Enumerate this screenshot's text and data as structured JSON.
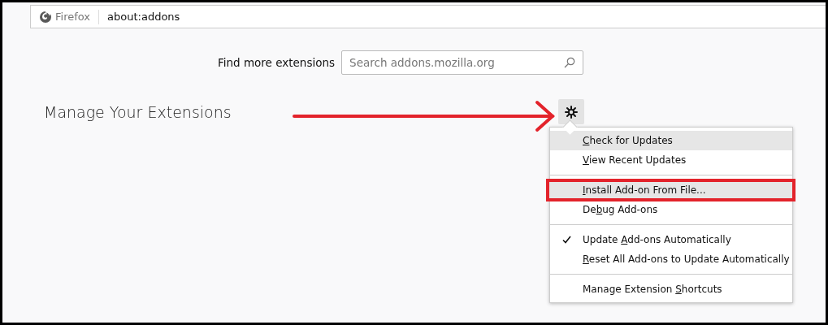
{
  "url_bar": {
    "identity": "Firefox",
    "url": "about:addons"
  },
  "find_more": {
    "label": "Find more extensions",
    "placeholder": "Search addons.mozilla.org"
  },
  "heading": "Manage Your Extensions",
  "annotation_arrow": {
    "kind": "arrow"
  },
  "menu": {
    "groups": [
      [
        {
          "label_parts": [
            {
              "text": "C",
              "underlined": true
            },
            {
              "text": "heck for Updates",
              "underlined": false
            }
          ],
          "selected": true,
          "checked": false,
          "outlined": false
        },
        {
          "label_parts": [
            {
              "text": "V",
              "underlined": true
            },
            {
              "text": "iew Recent Updates",
              "underlined": false
            }
          ],
          "selected": false,
          "checked": false,
          "outlined": false
        }
      ],
      [
        {
          "label_parts": [
            {
              "text": "I",
              "underlined": true
            },
            {
              "text": "nstall Add-on From File...",
              "underlined": false
            }
          ],
          "selected": true,
          "checked": false,
          "outlined": true
        },
        {
          "label_parts": [
            {
              "text": "De",
              "underlined": false
            },
            {
              "text": "b",
              "underlined": true
            },
            {
              "text": "ug Add-ons",
              "underlined": false
            }
          ],
          "selected": false,
          "checked": false,
          "outlined": false
        }
      ],
      [
        {
          "label_parts": [
            {
              "text": "Update ",
              "underlined": false
            },
            {
              "text": "A",
              "underlined": true
            },
            {
              "text": "dd-ons Automatically",
              "underlined": false
            }
          ],
          "selected": false,
          "checked": true,
          "outlined": false
        },
        {
          "label_parts": [
            {
              "text": "R",
              "underlined": true
            },
            {
              "text": "eset All Add-ons to Update Automatically",
              "underlined": false
            }
          ],
          "selected": false,
          "checked": false,
          "outlined": false
        }
      ],
      [
        {
          "label_parts": [
            {
              "text": "Manage Extension ",
              "underlined": false
            },
            {
              "text": "S",
              "underlined": true
            },
            {
              "text": "hortcuts",
              "underlined": false
            }
          ],
          "selected": false,
          "checked": false,
          "outlined": false
        }
      ]
    ]
  }
}
